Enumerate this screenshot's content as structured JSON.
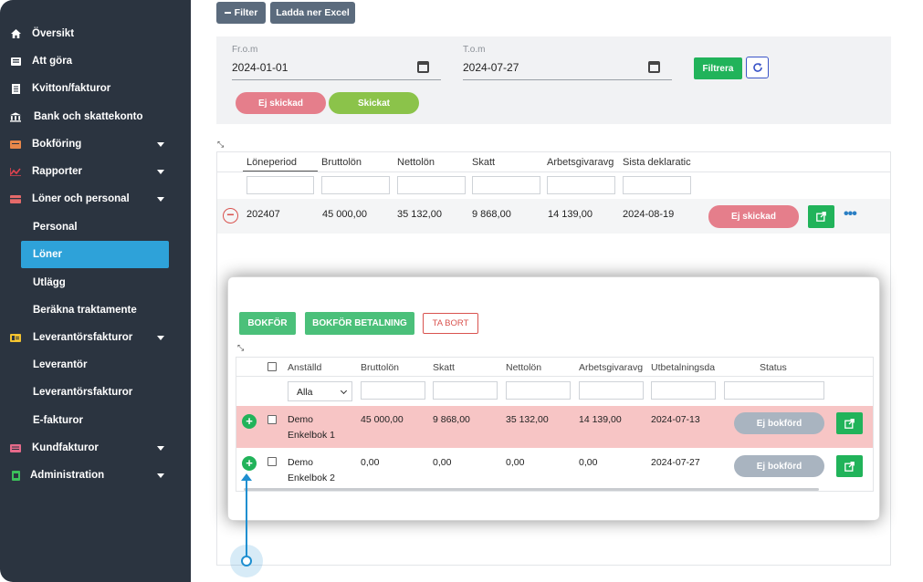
{
  "colors": {
    "sidebar_bg": "#2b3440",
    "active": "#2ea2d9",
    "green": "#21b35a",
    "pink": "#e57e8b",
    "lime": "#8bc34a",
    "row_error": "#f7c5c5"
  },
  "sidebar": {
    "items": [
      {
        "label": "Översikt",
        "icon": "home-icon"
      },
      {
        "label": "Att göra",
        "icon": "list-icon"
      },
      {
        "label": "Kvitton/fakturor",
        "icon": "receipt-icon"
      },
      {
        "label": "Bank och skattekonto",
        "icon": "bank-icon"
      },
      {
        "label": "Bokföring",
        "icon": "ledger-icon"
      },
      {
        "label": "Rapporter",
        "icon": "chart-icon"
      },
      {
        "label": "Löner och personal",
        "icon": "wallet-icon"
      },
      {
        "label": "Leverantörsfakturor",
        "icon": "invoice-icon"
      },
      {
        "label": "Kundfakturor",
        "icon": "customer-invoice-icon"
      },
      {
        "label": "Administration",
        "icon": "admin-icon"
      }
    ],
    "sub_personal": [
      "Personal",
      "Löner",
      "Utlägg",
      "Beräkna traktamente"
    ],
    "sub_leverantor": [
      "Leverantör",
      "Leverantörsfakturor",
      "E-fakturor"
    ]
  },
  "toolbar": {
    "filter_label": "Filter",
    "download_label": "Ladda ner Excel"
  },
  "filter": {
    "from_label": "Fr.o.m",
    "from_value": "2024-01-01",
    "to_label": "T.o.m",
    "to_value": "2024-07-27",
    "filter_button": "Filtrera",
    "not_sent": "Ej skickad",
    "sent": "Skickat"
  },
  "salary_table": {
    "headers": [
      "Löneperiod",
      "Bruttolön",
      "Nettolön",
      "Skatt",
      "Arbetsgivaravg",
      "Sista deklaratic"
    ],
    "row": {
      "period": "202407",
      "brutto": "45 000,00",
      "netto": "35 132,00",
      "skatt": "9 868,00",
      "avgift": "14 139,00",
      "deklaration": "2024-08-19",
      "status": "Ej skickad"
    }
  },
  "popup": {
    "btn_bokfor": "BOKFÖR",
    "btn_bokfor_betalning": "BOKFÖR BETALNING",
    "btn_ta_bort": "TA BORT",
    "headers": [
      "Anställd",
      "Bruttolön",
      "Skatt",
      "Nettolön",
      "Arbetsgivaravg",
      "Utbetalningsda",
      "Status"
    ],
    "filter_select": "Alla",
    "rows": [
      {
        "name1": "Demo",
        "name2": "Enkelbok 1",
        "brutto": "45 000,00",
        "skatt": "9 868,00",
        "netto": "35 132,00",
        "avgift": "14 139,00",
        "datum": "2024-07-13",
        "status": "Ej bokförd"
      },
      {
        "name1": "Demo",
        "name2": "Enkelbok 2",
        "brutto": "0,00",
        "skatt": "0,00",
        "netto": "0,00",
        "avgift": "0,00",
        "datum": "2024-07-27",
        "status": "Ej bokförd"
      }
    ]
  }
}
